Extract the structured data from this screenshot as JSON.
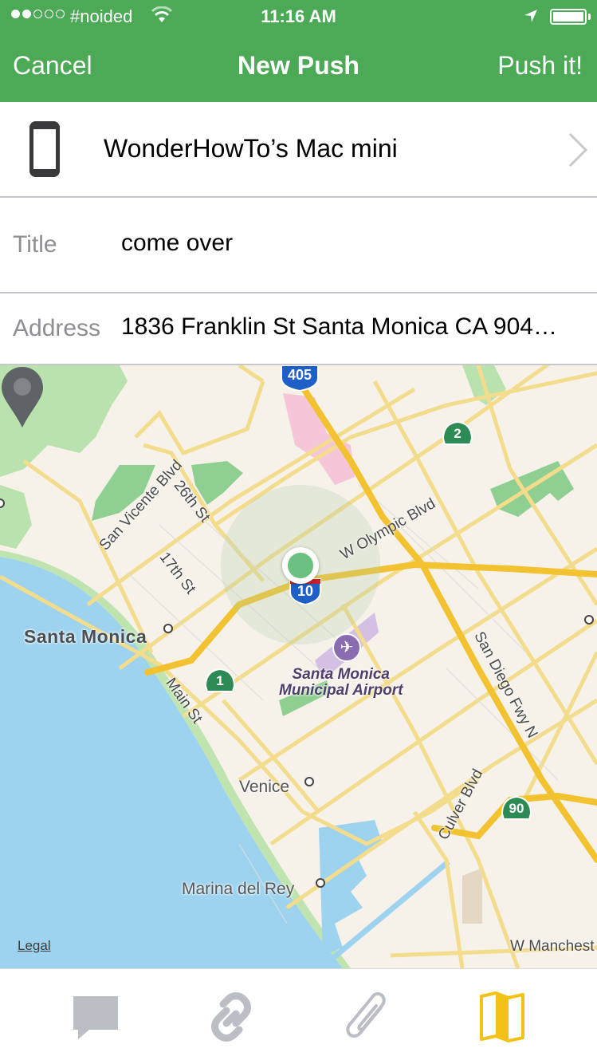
{
  "status_bar": {
    "signal_dots_filled": 2,
    "signal_dots_total": 5,
    "carrier": "#noided",
    "time": "11:16 AM",
    "battery_level": 1.0
  },
  "nav": {
    "cancel_label": "Cancel",
    "title": "New Push",
    "push_label": "Push it!"
  },
  "device": {
    "icon": "phone-icon",
    "name": "WonderHowTo’s Mac mini"
  },
  "fields": {
    "title_label": "Title",
    "title_value": "come over",
    "address_label": "Address",
    "address_value": "1836 Franklin St Santa Monica CA 904…"
  },
  "map": {
    "labels": {
      "santa_monica": "Santa Monica",
      "venice": "Venice",
      "marina_del_rey": "Marina del Rey",
      "san_vicente": "San Vicente Blvd",
      "26th": "26th St",
      "17th": "17th St",
      "main_st": "Main St",
      "w_olympic": "W Olympic Blvd",
      "san_diego_fwy": "San Diego Fwy N",
      "culver_blvd": "Culver Blvd",
      "w_manchester": "W Manchest",
      "airport_line1": "Santa Monica",
      "airport_line2": "Municipal Airport"
    },
    "shields": {
      "i405": "405",
      "i10": "10",
      "ca1": "1",
      "ca2": "2",
      "ca90": "90"
    },
    "legal": "Legal",
    "colors": {
      "water": "#9dd3ee",
      "land": "#f6f2ea",
      "park": "#a8dba0",
      "road_minor": "#f3dc8c",
      "freeway": "#f2c230"
    }
  },
  "tabs": [
    {
      "icon": "note-icon",
      "active": false
    },
    {
      "icon": "link-icon",
      "active": false
    },
    {
      "icon": "paperclip-icon",
      "active": false
    },
    {
      "icon": "map-icon",
      "active": true
    }
  ],
  "colors": {
    "header_bg": "#4caa57",
    "tab_inactive": "#bbbec4",
    "tab_active": "#f2c316"
  }
}
